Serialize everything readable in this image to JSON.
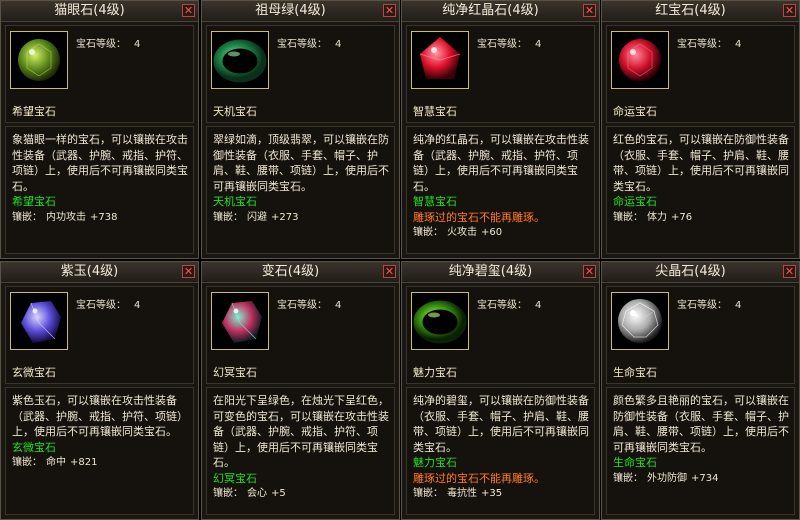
{
  "ui": {
    "close_glyph": "✕",
    "level_label": "宝石等级：",
    "inlay_label": "镶嵌："
  },
  "colors": {
    "text": "#efe6d2",
    "category": "#22e022",
    "warning": "#ff7a28",
    "close": "#ff5555"
  },
  "cards": [
    {
      "id": "cat-eye",
      "title": "猫眼石(4级)",
      "level": "4",
      "category": "希望宝石",
      "desc": "象猫眼一样的宝石，可以镶嵌在攻击性装备（武器、护腕、戒指、护符、项链）上，使用后不可再镶嵌同类宝石。",
      "warning": "",
      "stat": "内功攻击",
      "value": "+738",
      "gem": {
        "icon": "cat-eye-gem-icon",
        "shape": "round",
        "c1": "#d6f06a",
        "c2": "#5c8a1a",
        "c3": "#1d2a06"
      }
    },
    {
      "id": "jadeite",
      "title": "祖母绿(4级)",
      "level": "4",
      "category": "天机宝石",
      "desc": "翠绿如滴，顶级翡翠，可以镶嵌在防御性装备（衣服、手套、帽子、护肩、鞋、腰带、项链）上，使用后不可再镶嵌同类宝石。",
      "warning": "",
      "stat": "闪避",
      "value": "+273",
      "gem": {
        "icon": "jade-bracelet-icon",
        "shape": "ring",
        "c1": "#9ff0b0",
        "c2": "#1e8a4c",
        "c3": "#093018"
      }
    },
    {
      "id": "pure-ruby",
      "title": "纯净红晶石(4级)",
      "level": "4",
      "category": "智慧宝石",
      "desc": "纯净的红晶石，可以镶嵌在攻击性装备（武器、护腕、戒指、护符、项链）上，使用后不可再镶嵌同类宝石。",
      "warning": "雕琢过的宝石不能再雕琢。",
      "stat": "火攻击",
      "value": "+60",
      "gem": {
        "icon": "red-crystal-icon",
        "shape": "crystal",
        "c1": "#ff9aa8",
        "c2": "#e2112c",
        "c3": "#3b0208"
      }
    },
    {
      "id": "ruby",
      "title": "红宝石(4级)",
      "level": "4",
      "category": "命运宝石",
      "desc": "红色的宝石，可以镶嵌在防御性装备（衣服、手套、帽子、护肩、鞋、腰带、项链）上，使用后不可再镶嵌同类宝石。",
      "warning": "",
      "stat": "体力",
      "value": "+76",
      "gem": {
        "icon": "ruby-gem-icon",
        "shape": "round",
        "c1": "#ff8a9a",
        "c2": "#d0102a",
        "c3": "#2e0006"
      }
    },
    {
      "id": "amethyst",
      "title": "紫玉(4级)",
      "level": "4",
      "category": "玄微宝石",
      "desc": "紫色玉石，可以镶嵌在攻击性装备（武器、护腕、戒指、护符、项链）上，使用后不可再镶嵌同类宝石。",
      "warning": "",
      "stat": "命中",
      "value": "+821",
      "gem": {
        "icon": "purple-jade-icon",
        "shape": "shard",
        "c1": "#d8d4ff",
        "c2": "#5a4cd8",
        "c3": "#140a40"
      }
    },
    {
      "id": "alexandrite",
      "title": "变石(4级)",
      "level": "4",
      "category": "幻冥宝石",
      "desc": "在阳光下呈绿色，在烛光下呈红色，可变色的宝石，可以镶嵌在攻击性装备（武器、护腕、戒指、护符、项链）上，使用后不可再镶嵌同类宝石。",
      "warning": "",
      "stat": "会心",
      "value": "+5",
      "gem": {
        "icon": "alexandrite-icon",
        "shape": "shard",
        "c1": "#7ef0d0",
        "c2": "#c03060",
        "c3": "#0e1a22"
      }
    },
    {
      "id": "pure-jasper",
      "title": "纯净碧玺(4级)",
      "level": "4",
      "category": "魅力宝石",
      "desc": "纯净的碧玺，可以镶嵌在防御性装备（衣服、手套、帽子、护肩、鞋、腰带、项链）上，使用后不可再镶嵌同类宝石。",
      "warning": "雕琢过的宝石不能再雕琢。",
      "stat": "毒抗性",
      "value": "+35",
      "gem": {
        "icon": "green-jasper-icon",
        "shape": "ring",
        "c1": "#c8ff7a",
        "c2": "#3a9a12",
        "c3": "#0a2204"
      }
    },
    {
      "id": "diamond",
      "title": "尖晶石(4级)",
      "level": "4",
      "category": "生命宝石",
      "desc": "颜色繁多且艳丽的宝石，可以镶嵌在防御性装备（衣服、手套、帽子、护肩、鞋、腰带、项链）上，使用后不可再镶嵌同类宝石。",
      "warning": "",
      "stat": "外功防御",
      "value": "+734",
      "gem": {
        "icon": "diamond-gem-icon",
        "shape": "diamond",
        "c1": "#ffffff",
        "c2": "#a8a8a8",
        "c3": "#1c1c1c"
      }
    }
  ]
}
